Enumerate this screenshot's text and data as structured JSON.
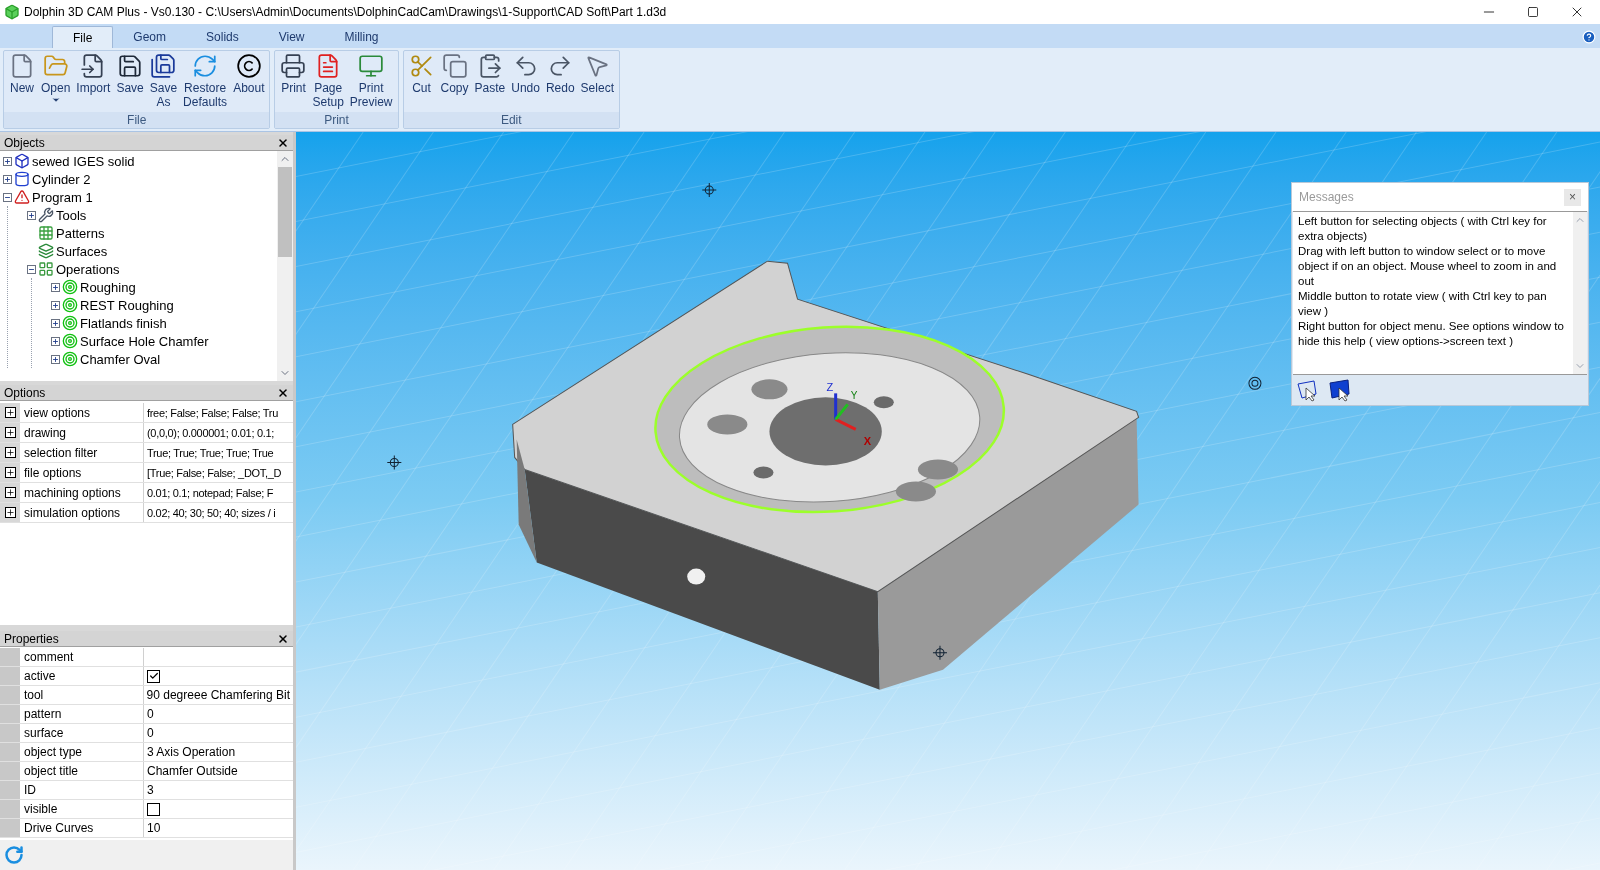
{
  "window": {
    "title": "Dolphin 3D CAM Plus - Vs0.130 - C:\\Users\\Admin\\Documents\\DolphinCadCam\\Drawings\\1-Support\\CAD Soft\\Part 1.d3d"
  },
  "tabs": [
    {
      "label": "File",
      "selected": true
    },
    {
      "label": "Geom",
      "selected": false
    },
    {
      "label": "Solids",
      "selected": false
    },
    {
      "label": "View",
      "selected": false
    },
    {
      "label": "Milling",
      "selected": false
    }
  ],
  "ribbon": [
    {
      "label": "File",
      "buttons": [
        {
          "kind": "new",
          "lines": [
            "New"
          ]
        },
        {
          "kind": "open",
          "lines": [
            "Open"
          ],
          "dropdown": true
        },
        {
          "kind": "import",
          "lines": [
            "Import"
          ]
        },
        {
          "kind": "save",
          "lines": [
            "Save"
          ]
        },
        {
          "kind": "saveas",
          "lines": [
            "Save",
            "As"
          ]
        },
        {
          "kind": "restore",
          "lines": [
            "Restore",
            "Defaults"
          ]
        },
        {
          "kind": "about",
          "lines": [
            "About"
          ]
        }
      ]
    },
    {
      "label": "Print",
      "buttons": [
        {
          "kind": "print",
          "lines": [
            "Print"
          ]
        },
        {
          "kind": "pagesetup",
          "lines": [
            "Page",
            "Setup"
          ]
        },
        {
          "kind": "preview",
          "lines": [
            "Print",
            "Preview"
          ]
        }
      ]
    },
    {
      "label": "Edit",
      "buttons": [
        {
          "kind": "cut",
          "lines": [
            "Cut"
          ]
        },
        {
          "kind": "copy",
          "lines": [
            "Copy"
          ]
        },
        {
          "kind": "paste",
          "lines": [
            "Paste"
          ]
        },
        {
          "kind": "undo",
          "lines": [
            "Undo"
          ]
        },
        {
          "kind": "redo",
          "lines": [
            "Redo"
          ]
        },
        {
          "kind": "select",
          "lines": [
            "Select"
          ]
        }
      ]
    }
  ],
  "objects": {
    "title": "Objects",
    "items": [
      {
        "label": "sewed IGES solid",
        "kind": "solid",
        "expanded": false
      },
      {
        "label": "Cylinder 2",
        "kind": "cylinder",
        "expanded": false
      },
      {
        "label": "Program 1",
        "kind": "program",
        "expanded": true,
        "children": [
          {
            "label": "Tools",
            "kind": "tools",
            "expanded": false
          },
          {
            "label": "Patterns",
            "kind": "patterns"
          },
          {
            "label": "Surfaces",
            "kind": "surfaces"
          },
          {
            "label": "Operations",
            "kind": "operations",
            "expanded": true,
            "children": [
              {
                "label": "Roughing",
                "kind": "operation",
                "expanded": false
              },
              {
                "label": "REST Roughing",
                "kind": "operation",
                "expanded": false
              },
              {
                "label": "Flatlands finish",
                "kind": "operation",
                "expanded": false
              },
              {
                "label": "Surface Hole Chamfer",
                "kind": "operation",
                "expanded": false
              },
              {
                "label": "Chamfer Oval",
                "kind": "operation",
                "expanded": false
              }
            ]
          }
        ]
      }
    ]
  },
  "options": {
    "title": "Options",
    "rows": [
      {
        "name": "view options",
        "value": "free; False; False; False; Tru"
      },
      {
        "name": "drawing",
        "value": "(0,0,0); 0.000001; 0.01; 0.1;"
      },
      {
        "name": "selection filter",
        "value": "True; True; True; True; True"
      },
      {
        "name": "file options",
        "value": "[True; False; False; _DOT,_D"
      },
      {
        "name": "machining options",
        "value": "0.01; 0.1; notepad; False; F"
      },
      {
        "name": "simulation options",
        "value": "0.02; 40; 30; 50; 40; sizes / i"
      }
    ]
  },
  "properties": {
    "title": "Properties",
    "rows": [
      {
        "name": "comment",
        "kind": "text",
        "value": ""
      },
      {
        "name": "active",
        "kind": "checkbox",
        "checked": true
      },
      {
        "name": "tool",
        "kind": "text",
        "value": "90 degreee Chamfering Bit"
      },
      {
        "name": "pattern",
        "kind": "text",
        "value": "0"
      },
      {
        "name": "surface",
        "kind": "text",
        "value": "0"
      },
      {
        "name": "object type",
        "kind": "text",
        "value": "3 Axis Operation"
      },
      {
        "name": "object title",
        "kind": "text",
        "value": "Chamfer Outside"
      },
      {
        "name": "ID",
        "kind": "text",
        "value": "3"
      },
      {
        "name": "visible",
        "kind": "checkbox",
        "checked": false
      },
      {
        "name": "Drive Curves",
        "kind": "text",
        "value": "10"
      }
    ]
  },
  "messages": {
    "title": "Messages",
    "close": "×",
    "lines": [
      "Left button for selecting objects ( with Ctrl key for extra objects)",
      "Drag with left button to window select or to move object if on an object. Mouse wheel to zoom in and out",
      "Middle button to rotate view ( with Ctrl key to pan view )",
      "Right button for object menu. See options window to hide this help ( view options->screen text )"
    ]
  },
  "viewport": {
    "axes": {
      "x": "X",
      "y": "Y",
      "z": "Z"
    }
  }
}
